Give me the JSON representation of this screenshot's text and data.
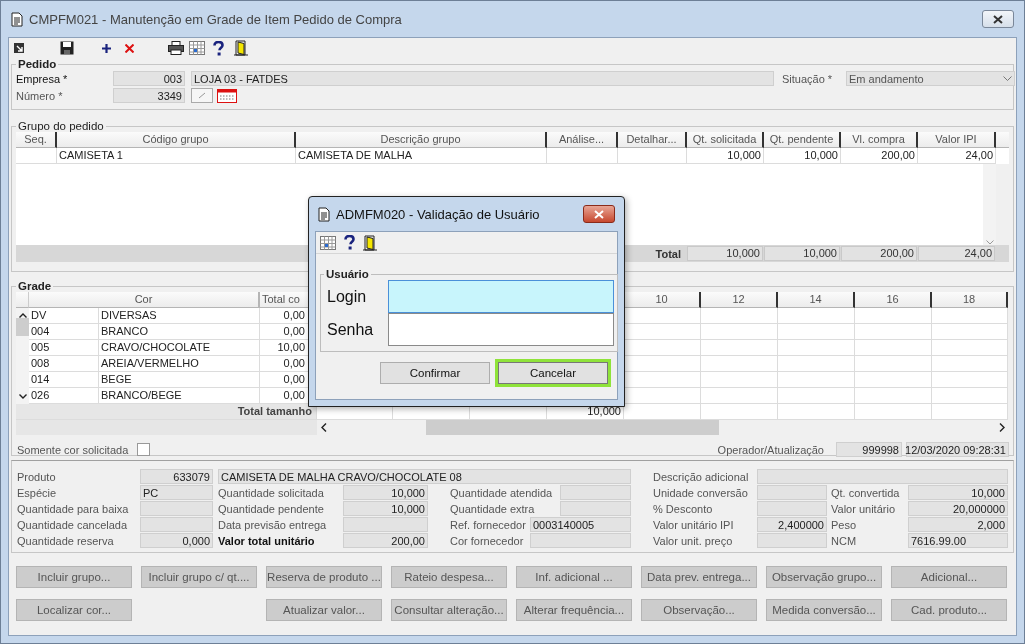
{
  "window": {
    "title": "CMPFM021 - Manutenção em Grade de Item Pedido de Compra"
  },
  "pedido": {
    "title": "Pedido",
    "empresa": {
      "label": "Empresa *",
      "code": "003",
      "name": "LOJA 03 - FATDES"
    },
    "numero": {
      "label": "Número *",
      "value": "3349"
    },
    "situacao": {
      "label": "Situação *",
      "value": "Em andamento"
    }
  },
  "grupo": {
    "title": "Grupo do pedido",
    "columns": [
      "Seq.",
      "Código grupo",
      "Descrição grupo",
      "Análise...",
      "Detalhar...",
      "Qt. solicitada",
      "Qt. pendente",
      "Vl. compra",
      "Valor IPI"
    ],
    "rows": [
      {
        "codigo": "CAMISETA 1",
        "descricao": "CAMISETA DE MALHA",
        "qt_solicitada": "10,000",
        "qt_pendente": "10,000",
        "vl_compra": "200,00",
        "valor_ipi": "24,00"
      }
    ],
    "total": {
      "label": "Total",
      "values": [
        "10,000",
        "10,000",
        "200,00",
        "24,00"
      ]
    }
  },
  "grade": {
    "title": "Grade",
    "cor_header": "Cor",
    "total_header": "Total co",
    "size_columns": [
      {},
      {},
      {},
      {
        "total": "10,000"
      },
      {
        "header": "10"
      },
      {
        "header": "12"
      },
      {
        "header": "14"
      },
      {
        "header": "16"
      },
      {
        "header": "18"
      }
    ],
    "rows": [
      {
        "code": "DV",
        "cor": "DIVERSAS",
        "total": "0,00"
      },
      {
        "code": "004",
        "cor": "BRANCO",
        "total": "0,00"
      },
      {
        "code": "005",
        "cor": "CRAVO/CHOCOLATE",
        "total": "10,00"
      },
      {
        "code": "008",
        "cor": "AREIA/VERMELHO",
        "total": "0,00"
      },
      {
        "code": "014",
        "cor": "BEGE",
        "total": "0,00"
      },
      {
        "code": "026",
        "cor": "BRANCO/BEGE",
        "total": "0,00"
      }
    ],
    "total_label": "Total tamanho",
    "somente": {
      "label": "Somente cor solicitada",
      "checked": false
    },
    "operador": {
      "label": "Operador/Atualização",
      "code": "999998",
      "datetime": "12/03/2020 09:28:31"
    }
  },
  "produto": {
    "label": "Produto",
    "code": "633079",
    "description": "CAMISETA DE MALHA CRAVO/CHOCOLATE 08",
    "extra_label": "Descrição adicional"
  },
  "details": [
    [
      {
        "label": "Espécie",
        "value": "PC",
        "kind": "text",
        "bold": false
      },
      {
        "label": "Quantidade solicitada",
        "value": "10,000",
        "kind": "number",
        "bold": false
      },
      {
        "label": "Quantidade atendida",
        "kind": "number",
        "bold": false
      },
      {
        "label": "Unidade conversão",
        "kind": "number",
        "bold": false
      },
      {
        "label": "Qt. convertida",
        "value": "10,000",
        "kind": "number",
        "bold": false
      }
    ],
    [
      {
        "label": "Quantidade para baixa",
        "kind": "number",
        "bold": false
      },
      {
        "label": "Quantidade pendente",
        "value": "10,000",
        "kind": "number",
        "bold": false
      },
      {
        "label": "Quantidade extra",
        "kind": "number",
        "bold": false
      },
      {
        "label": "% Desconto",
        "kind": "number",
        "bold": false
      },
      {
        "label": "Valor unitário",
        "value": "20,000000",
        "kind": "number",
        "bold": false
      }
    ],
    [
      {
        "label": "Quantidade cancelada",
        "kind": "number",
        "bold": false
      },
      {
        "label": "Data previsão entrega",
        "kind": "text",
        "bold": false
      },
      {
        "label": "Ref. fornecedor",
        "value": "0003140005",
        "kind": "text",
        "bold": false
      },
      {
        "label": "Valor unitário IPI",
        "value": "2,400000",
        "kind": "number",
        "bold": false
      },
      {
        "label": "Peso",
        "value": "2,000",
        "kind": "number",
        "bold": false
      }
    ],
    [
      {
        "label": "Quantidade reserva",
        "value": "0,000",
        "kind": "number",
        "bold": false
      },
      {
        "label": "Valor total unitário",
        "value": "200,00",
        "kind": "number",
        "bold": true
      },
      {
        "label": "Cor fornecedor",
        "kind": "text",
        "bold": false
      },
      {
        "label": "Valor unit. preço",
        "kind": "number",
        "bold": false
      },
      {
        "label": "NCM",
        "value": "7616.99.00",
        "kind": "text",
        "bold": false
      }
    ]
  ],
  "buttons": [
    [
      {
        "kind": "button",
        "label": "Incluir grupo..."
      },
      {
        "kind": "button",
        "label": "Incluir grupo c/ qt...."
      },
      {
        "kind": "button",
        "label": "Reserva de produto ..."
      },
      {
        "kind": "button",
        "label": "Rateio despesa..."
      },
      {
        "kind": "button",
        "label": "Inf. adicional ..."
      },
      {
        "kind": "button",
        "label": "Data prev. entrega..."
      },
      {
        "kind": "button",
        "label": "Observação grupo..."
      },
      {
        "kind": "button",
        "label": "Adicional..."
      }
    ],
    [
      {
        "kind": "button",
        "label": "Localizar cor..."
      },
      {
        "kind": "spacer"
      },
      {
        "kind": "button",
        "label": "Atualizar valor..."
      },
      {
        "kind": "button",
        "label": "Consultar alteração..."
      },
      {
        "kind": "button",
        "label": "Alterar frequência..."
      },
      {
        "kind": "button",
        "label": "Observação..."
      },
      {
        "kind": "button",
        "label": "Medida conversão..."
      },
      {
        "kind": "button",
        "label": "Cad. produto..."
      }
    ]
  ],
  "dialog": {
    "title": "ADMFM020 - Validação de Usuário",
    "group": "Usuário",
    "fields": [
      {
        "label": "Login",
        "focused": true
      },
      {
        "label": "Senha",
        "focused": false
      }
    ],
    "buttons": [
      {
        "label": "Confirmar",
        "focused": false
      },
      {
        "label": "Cancelar",
        "focused": true
      }
    ]
  }
}
